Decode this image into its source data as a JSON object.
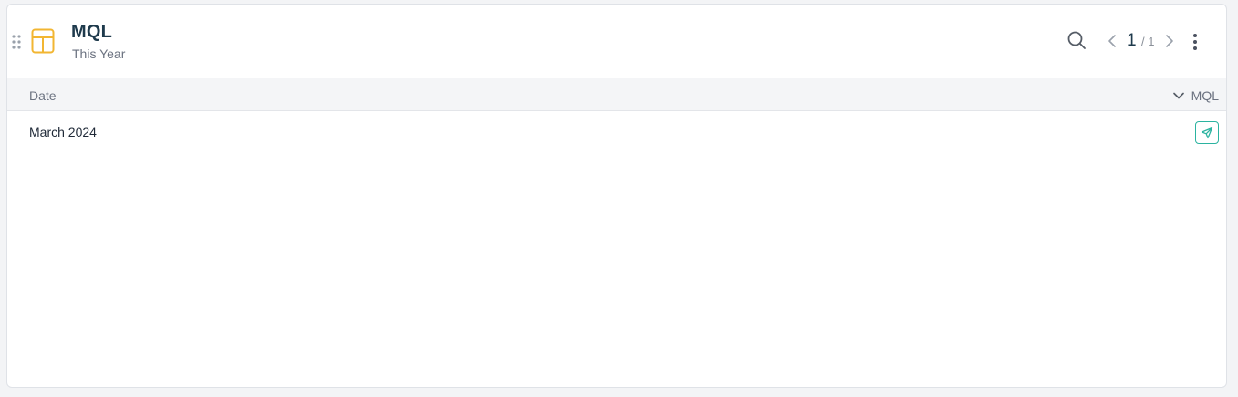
{
  "widget": {
    "title": "MQL",
    "subtitle": "This Year",
    "icon": "table-icon",
    "accent_color": "#f2b632"
  },
  "pagination": {
    "current": "1",
    "total_label": "/ 1"
  },
  "table": {
    "columns": [
      {
        "label": "Date"
      },
      {
        "label": "MQL",
        "sort_icon": "chevron-down-icon"
      }
    ],
    "rows": [
      {
        "date": "March 2024",
        "action_icon": "send-icon",
        "action_color": "#2bb3a0"
      }
    ]
  }
}
